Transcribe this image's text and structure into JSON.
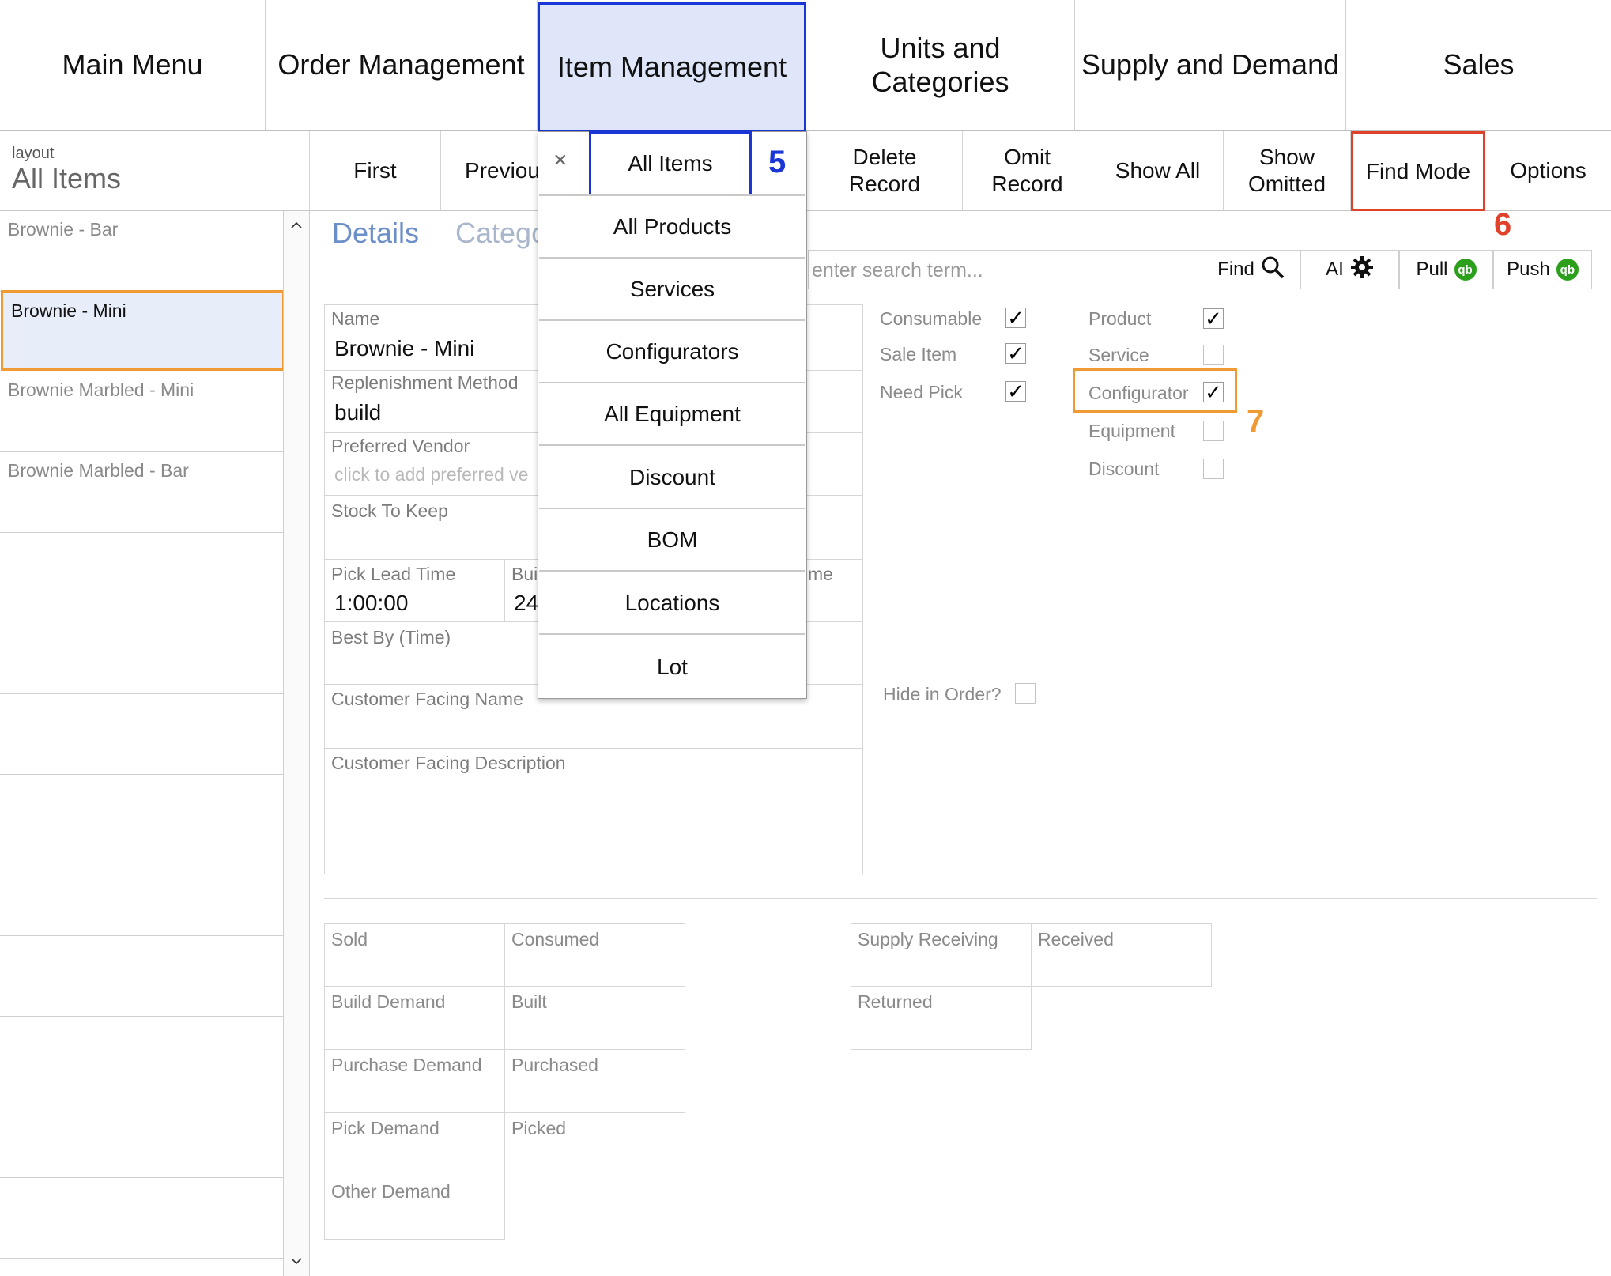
{
  "nav": {
    "main_menu": "Main Menu",
    "order_management": "Order Management",
    "item_management": "Item Management",
    "units_categories": "Units and Categories",
    "supply_demand": "Supply and Demand",
    "sales": "Sales"
  },
  "layout": {
    "label": "layout",
    "value": "All Items"
  },
  "toolbar": {
    "first": "First",
    "previous": "Previou",
    "delete_record": "Delete Record",
    "omit_record": "Omit Record",
    "show_all": "Show All",
    "show_omitted": "Show Omitted",
    "find_mode": "Find Mode",
    "options": "Options"
  },
  "list": {
    "items": [
      "Brownie - Bar",
      "Brownie - Mini",
      "Brownie Marbled - Mini",
      "Brownie Marbled - Bar"
    ],
    "scroll_up": "^",
    "scroll_down": "v"
  },
  "tabs": {
    "details": "Details",
    "categories": "Catego"
  },
  "search": {
    "placeholder": "enter search term...",
    "find": "Find",
    "ai": "AI",
    "pull": "Pull",
    "push": "Push",
    "qb_glyph": "qb"
  },
  "fields": {
    "name_label": "Name",
    "name_value": "Brownie - Mini",
    "replenishment_label": "Replenishment Method",
    "replenishment_value": "build",
    "vendor_label": "Preferred Vendor",
    "vendor_placeholder": "click to add preferred ve",
    "stock_label": "Stock To Keep",
    "pick_lead_label": "Pick Lead Time",
    "pick_lead_value": "1:00:00",
    "build_label": "Bui",
    "build_value": "24",
    "build_time_fragment": "me",
    "best_by_label": "Best By (Time)",
    "customer_name_label": "Customer Facing Name",
    "customer_desc_label": "Customer Facing Description"
  },
  "checkboxes": {
    "consumable": {
      "label": "Consumable",
      "checked": true
    },
    "sale_item": {
      "label": "Sale Item",
      "checked": true
    },
    "need_pick": {
      "label": "Need Pick",
      "checked": true
    },
    "product": {
      "label": "Product",
      "checked": true
    },
    "service": {
      "label": "Service",
      "checked": false
    },
    "configurator": {
      "label": "Configurator",
      "checked": true
    },
    "equipment": {
      "label": "Equipment",
      "checked": false
    },
    "discount": {
      "label": "Discount",
      "checked": false
    },
    "hide_in_order": {
      "label": "Hide in Order?",
      "checked": false
    },
    "check_glyph": "✓"
  },
  "stats": {
    "sold": "Sold",
    "consumed": "Consumed",
    "build_demand": "Build Demand",
    "built": "Built",
    "purchase_demand": "Purchase Demand",
    "purchased": "Purchased",
    "pick_demand": "Pick Demand",
    "picked": "Picked",
    "other_demand": "Other Demand",
    "supply_receiving": "Supply Receiving",
    "received": "Received",
    "returned": "Returned"
  },
  "dropdown": {
    "close": "×",
    "items": [
      "All Items",
      "All Products",
      "Services",
      "Configurators",
      "All Equipment",
      "Discount",
      "BOM",
      "Locations",
      "Lot"
    ]
  },
  "markers": {
    "m5": "5",
    "m6": "6",
    "m7": "7"
  },
  "colors": {
    "nav_active_bg": "#dfe6f9",
    "nav_active_border": "#1a36d6",
    "highlight_orange": "#ef9a32",
    "highlight_red": "#e0412b",
    "marker_blue": "#1a36d6",
    "quickbooks_green": "#2ca01c"
  }
}
